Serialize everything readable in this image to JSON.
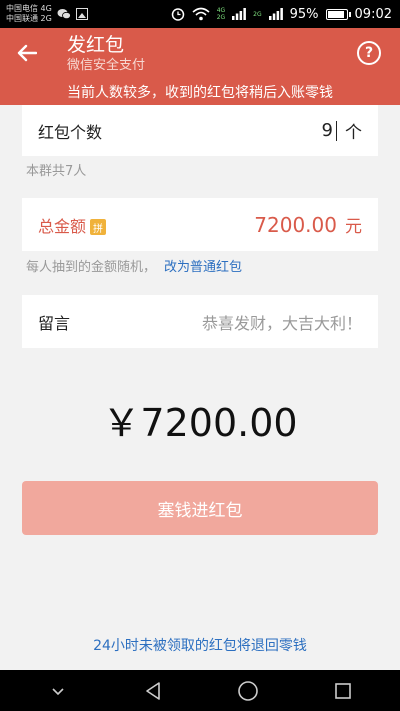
{
  "status_bar": {
    "carrier1": "中国电信 4G",
    "carrier2": "中国联通 2G",
    "net_top": "4G",
    "net_bottom": "2G",
    "net2_top": "2G",
    "battery": "95%",
    "battery_level": 0.95,
    "time": "09:02"
  },
  "header": {
    "title": "发红包",
    "subtitle": "微信安全支付",
    "help": "?"
  },
  "notice": "当前人数较多，收到的红包将稍后入账零钱",
  "count_row": {
    "label": "红包个数",
    "value": "9",
    "unit": "个"
  },
  "members_hint": "本群共7人",
  "total_row": {
    "label": "总金额",
    "badge": "拼",
    "value": "7200.00",
    "unit": "元"
  },
  "random_hint": {
    "text": "每人抽到的金额随机，",
    "link": "改为普通红包"
  },
  "message_row": {
    "label": "留言",
    "placeholder": "恭喜发财，大吉大利！"
  },
  "big_amount": "￥7200.00",
  "submit_label": "塞钱进红包",
  "bottom_note": "24小时未被领取的红包将退回零钱",
  "colors": {
    "brand_red": "#d95a4a",
    "button_disabled": "#f1a89d",
    "link_blue": "#2c6fc0"
  }
}
